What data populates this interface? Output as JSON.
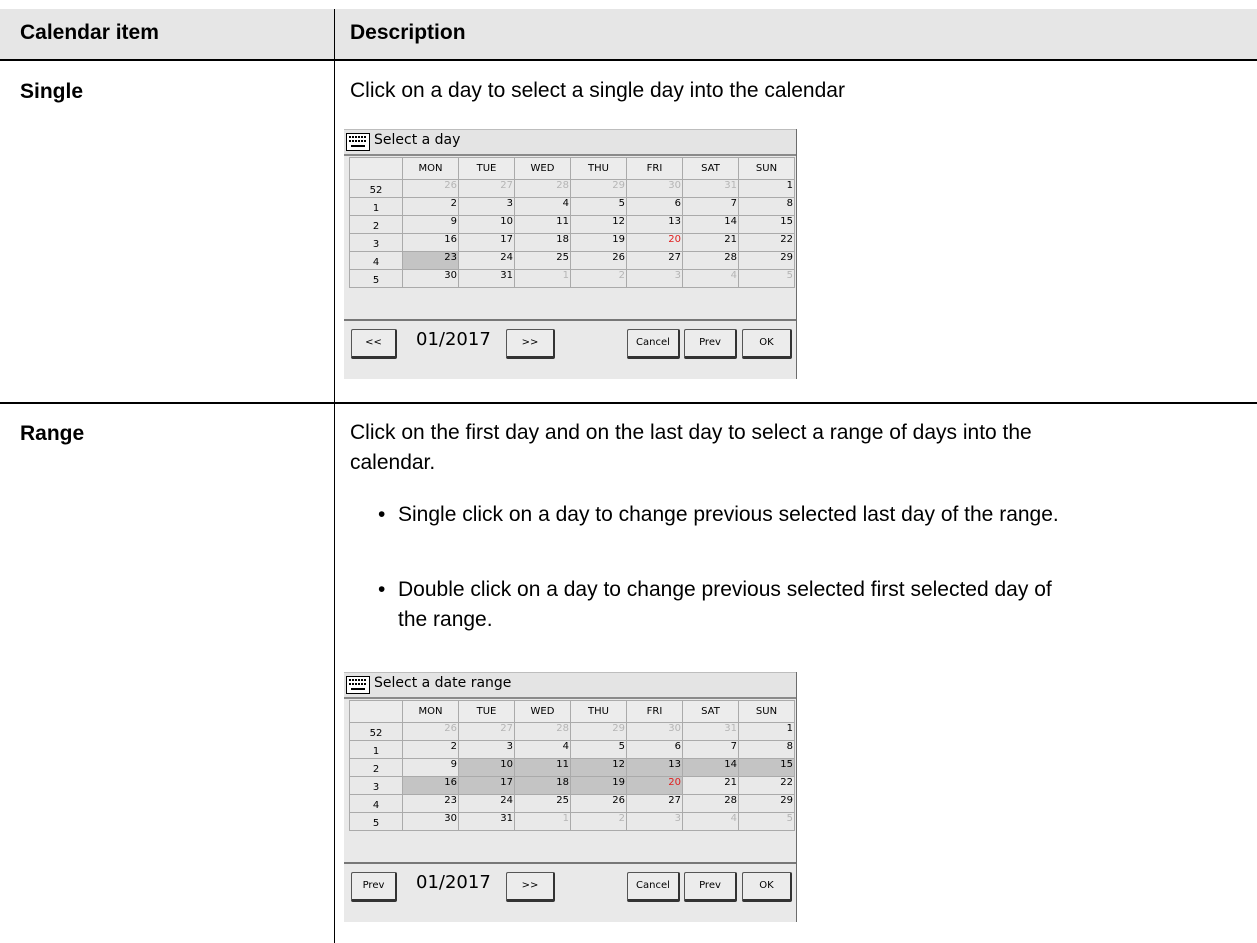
{
  "table": {
    "headers": [
      "Calendar item",
      "Description"
    ],
    "rows": [
      {
        "item": "Single",
        "description": "Click on a day to select a single day into the calendar"
      },
      {
        "item": "Range",
        "description_line1": "Click on the first day and on the last day to select a range of days into the",
        "description_line2": "calendar.",
        "bullets": [
          {
            "line1": "Single click on a day to change previous selected last day of the range."
          },
          {
            "line1": "Double click on a day to change previous selected first selected day of",
            "line2": "the range."
          }
        ]
      }
    ]
  },
  "calendar_single": {
    "title": "Select a day",
    "weekdays": [
      "MON",
      "TUE",
      "WED",
      "THU",
      "FRI",
      "SAT",
      "SUN"
    ],
    "weeks": [
      {
        "wk": "52",
        "days": [
          "26",
          "27",
          "28",
          "29",
          "30",
          "31",
          "1"
        ]
      },
      {
        "wk": "1",
        "days": [
          "2",
          "3",
          "4",
          "5",
          "6",
          "7",
          "8"
        ]
      },
      {
        "wk": "2",
        "days": [
          "9",
          "10",
          "11",
          "12",
          "13",
          "14",
          "15"
        ]
      },
      {
        "wk": "3",
        "days": [
          "16",
          "17",
          "18",
          "19",
          "20",
          "21",
          "22"
        ]
      },
      {
        "wk": "4",
        "days": [
          "23",
          "24",
          "25",
          "26",
          "27",
          "28",
          "29"
        ]
      },
      {
        "wk": "5",
        "days": [
          "30",
          "31",
          "1",
          "2",
          "3",
          "4",
          "5"
        ]
      }
    ],
    "prev_nav_label": "<<",
    "next_nav_label": ">>",
    "period": "01/2017",
    "cancel_label": "Cancel",
    "prev_label": "Prev",
    "ok_label": "OK"
  },
  "calendar_range": {
    "title": "Select a date range",
    "weekdays": [
      "MON",
      "TUE",
      "WED",
      "THU",
      "FRI",
      "SAT",
      "SUN"
    ],
    "weeks": [
      {
        "wk": "52",
        "days": [
          "26",
          "27",
          "28",
          "29",
          "30",
          "31",
          "1"
        ]
      },
      {
        "wk": "1",
        "days": [
          "2",
          "3",
          "4",
          "5",
          "6",
          "7",
          "8"
        ]
      },
      {
        "wk": "2",
        "days": [
          "9",
          "10",
          "11",
          "12",
          "13",
          "14",
          "15"
        ]
      },
      {
        "wk": "3",
        "days": [
          "16",
          "17",
          "18",
          "19",
          "20",
          "21",
          "22"
        ]
      },
      {
        "wk": "4",
        "days": [
          "23",
          "24",
          "25",
          "26",
          "27",
          "28",
          "29"
        ]
      },
      {
        "wk": "5",
        "days": [
          "30",
          "31",
          "1",
          "2",
          "3",
          "4",
          "5"
        ]
      }
    ],
    "prev_nav_label": "Prev",
    "next_nav_label": ">>",
    "period": "01/2017",
    "cancel_label": "Cancel",
    "prev_label": "Prev",
    "ok_label": "OK"
  },
  "colors": {
    "today": "#e02020",
    "selected": "#c4c4c4",
    "other_month": "#b5b5b5"
  }
}
